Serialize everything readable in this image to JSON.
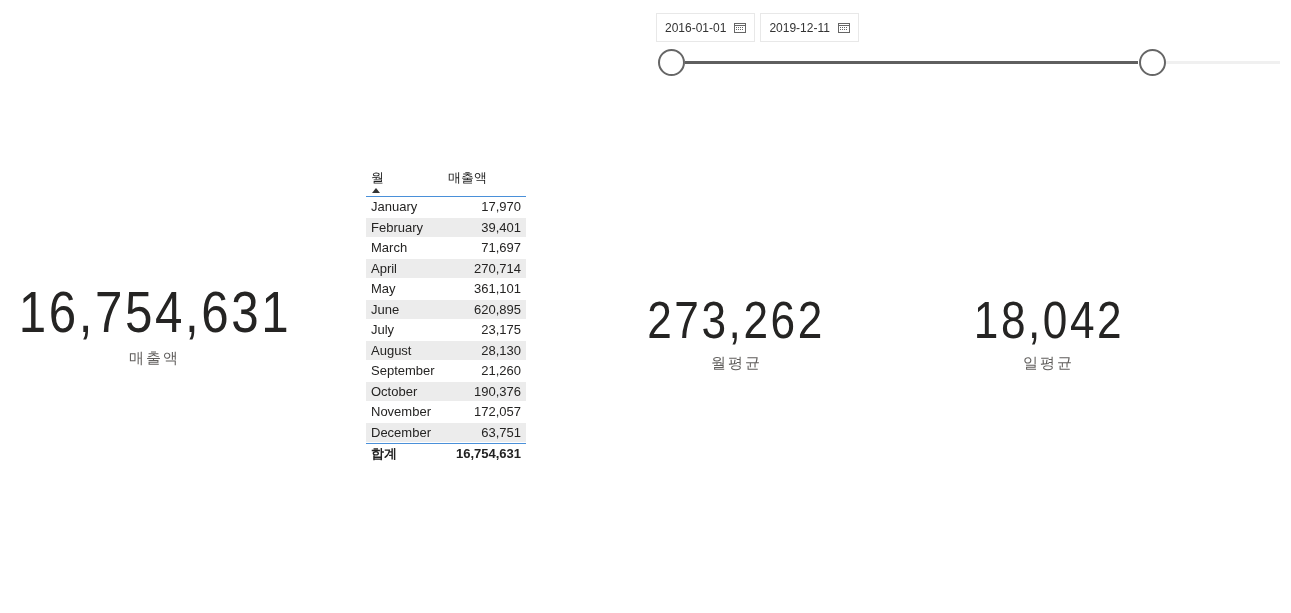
{
  "date_slicer": {
    "start": "2016-01-01",
    "end": "2019-12-11",
    "thumbs": [
      {
        "level": 0
      },
      {
        "level": 0.79
      }
    ]
  },
  "kpis": [
    {
      "value": "16,754,631",
      "label": "매출액"
    },
    {
      "value": "273,262",
      "label": "월평균"
    },
    {
      "value": "18,042",
      "label": "일평균"
    }
  ],
  "table": {
    "columns": [
      {
        "label": "월",
        "sorted": true
      },
      {
        "label": "매출액",
        "sorted": false
      }
    ],
    "rows": [
      [
        "January",
        "17,970"
      ],
      [
        "February",
        "39,401"
      ],
      [
        "March",
        "71,697"
      ],
      [
        "April",
        "270,714"
      ],
      [
        "May",
        "361,101"
      ],
      [
        "June",
        "620,895"
      ],
      [
        "July",
        "23,175"
      ],
      [
        "August",
        "28,130"
      ],
      [
        "September",
        "21,260"
      ],
      [
        "October",
        "190,376"
      ],
      [
        "November",
        "172,057"
      ],
      [
        "December",
        "63,751"
      ]
    ],
    "total": [
      "합계",
      "16,754,631"
    ]
  }
}
